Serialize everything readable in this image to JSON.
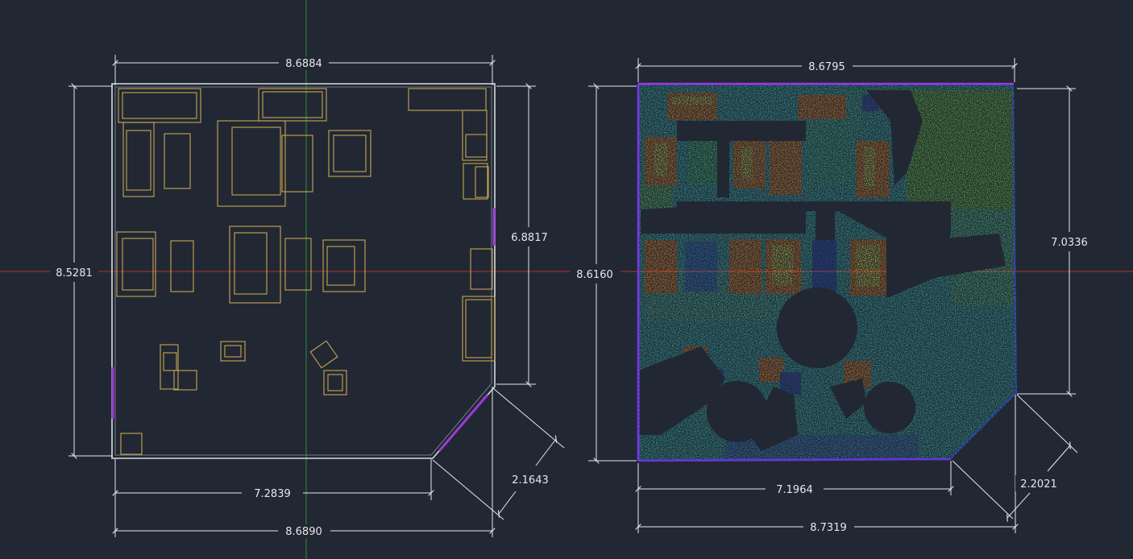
{
  "colors": {
    "background": "#212833",
    "dimension_line": "#e6e8ea",
    "wall": "#d9dde2",
    "furniture": "#c9a552",
    "door": "#9b3bd6",
    "axis_horizontal": "#b5302f",
    "axis_vertical": "#2f8f35",
    "scan_floor": "#36c0b6",
    "scan_wall_green": "#6ad13b",
    "scan_hot": "#ff8a1c",
    "scan_cold": "#1f4fd8"
  },
  "left_plan": {
    "dimensions": {
      "top_width": "8.6884",
      "left_height": "8.5281",
      "right_height": "6.8817",
      "bottom_inner": "7.2839",
      "bottom_total": "8.6890",
      "chamfer": "2.1643"
    }
  },
  "right_scan": {
    "dimensions": {
      "top_width": "8.6795",
      "left_height": "8.6160",
      "right_height": "7.0336",
      "bottom_inner": "7.1964",
      "bottom_total": "8.7319",
      "chamfer": "2.2021"
    }
  }
}
